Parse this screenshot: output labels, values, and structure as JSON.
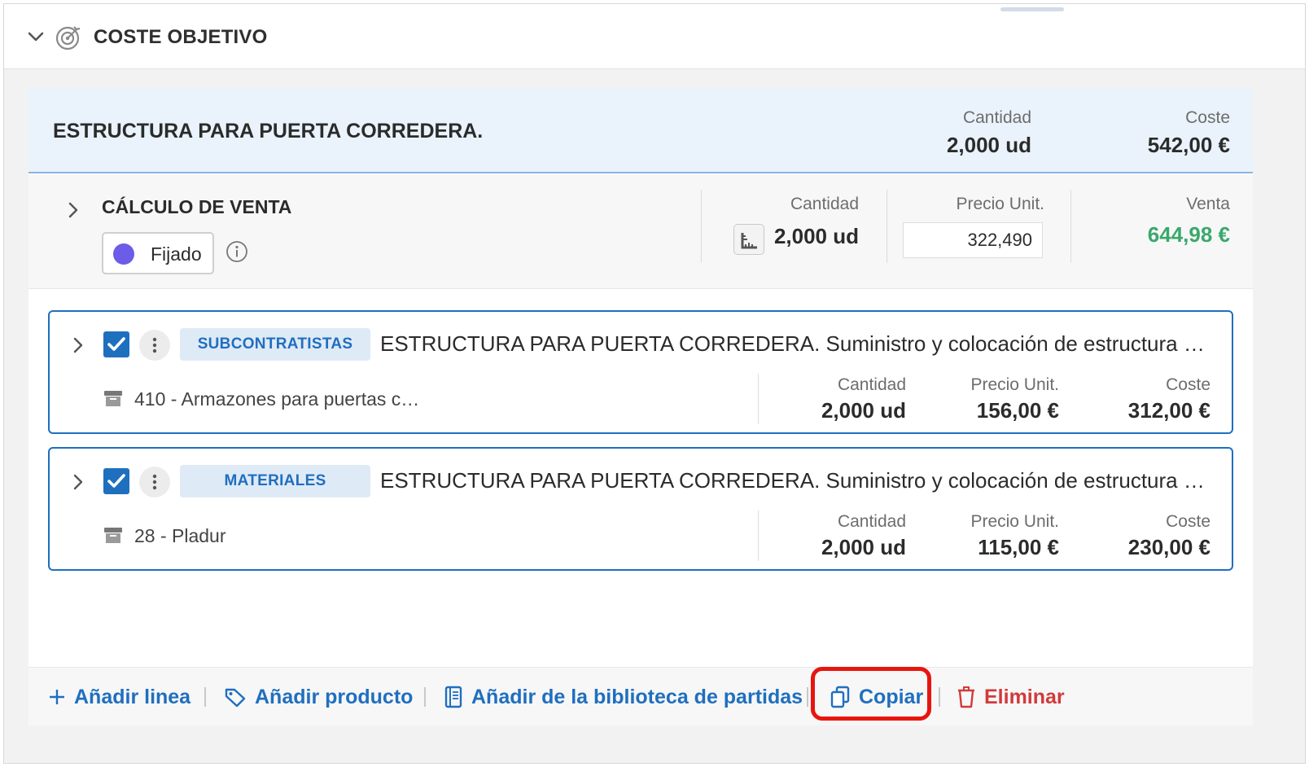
{
  "section": {
    "title": "COSTE OBJETIVO"
  },
  "summary": {
    "title": "ESTRUCTURA PARA PUERTA CORREDERA.",
    "cantidad_label": "Cantidad",
    "cantidad_value": "2,000 ud",
    "coste_label": "Coste",
    "coste_value": "542,00 €"
  },
  "venta": {
    "title": "CÁLCULO DE VENTA",
    "status": "Fijado",
    "cantidad_label": "Cantidad",
    "cantidad_value": "2,000 ud",
    "precio_label": "Precio Unit.",
    "precio_value": "322,490",
    "venta_label": "Venta",
    "venta_value": "644,98 €",
    "venta_color": "#3aa86b"
  },
  "lines": [
    {
      "tag": "SUBCONTRATISTAS",
      "description": "ESTRUCTURA PARA PUERTA CORREDERA. Suministro y colocación de estructura …",
      "code": "410 - Armazones para puertas c…",
      "cantidad_label": "Cantidad",
      "cantidad_value": "2,000 ud",
      "precio_label": "Precio Unit.",
      "precio_value": "156,00 €",
      "coste_label": "Coste",
      "coste_value": "312,00 €",
      "checked": true
    },
    {
      "tag": "MATERIALES",
      "description": "ESTRUCTURA PARA PUERTA CORREDERA. Suministro y colocación de estructura …",
      "code": "28 - Pladur",
      "cantidad_label": "Cantidad",
      "cantidad_value": "2,000 ud",
      "precio_label": "Precio Unit.",
      "precio_value": "115,00 €",
      "coste_label": "Coste",
      "coste_value": "230,00 €",
      "checked": true
    }
  ],
  "footer": {
    "add_line": "Añadir linea",
    "add_product": "Añadir producto",
    "add_library": "Añadir de la biblioteca de partidas",
    "copy": "Copiar",
    "delete": "Eliminar"
  },
  "colors": {
    "accent": "#1f6fbf",
    "danger": "#d23a3a",
    "highlight": "#e8150f",
    "status_dot": "#6c5ce7"
  },
  "icons": [
    "chevron-down-icon",
    "target-icon",
    "chevron-right-icon",
    "info-icon",
    "ruler-icon",
    "kebab-icon",
    "archive-box-icon",
    "plus-icon",
    "tag-icon",
    "book-icon",
    "copy-icon",
    "trash-icon"
  ]
}
